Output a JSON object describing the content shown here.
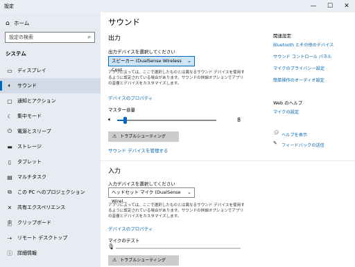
{
  "window": {
    "title": "設定",
    "minimize": "—",
    "maximize": "☐",
    "close": "✕"
  },
  "sidebar": {
    "home": {
      "label": "ホーム",
      "icon": "home-icon"
    },
    "search_placeholder": "設定の検索",
    "section": "システム",
    "items": [
      {
        "label": "ディスプレイ",
        "icon": "display-icon"
      },
      {
        "label": "サウンド",
        "icon": "speaker-icon"
      },
      {
        "label": "通知とアクション",
        "icon": "notification-icon"
      },
      {
        "label": "集中モード",
        "icon": "moon-icon"
      },
      {
        "label": "電源とスリープ",
        "icon": "power-icon"
      },
      {
        "label": "ストレージ",
        "icon": "storage-icon"
      },
      {
        "label": "タブレット",
        "icon": "tablet-icon"
      },
      {
        "label": "マルチタスク",
        "icon": "multitask-icon"
      },
      {
        "label": "この PC へのプロジェクション",
        "icon": "projection-icon"
      },
      {
        "label": "共有エクスペリエンス",
        "icon": "share-icon"
      },
      {
        "label": "クリップボード",
        "icon": "clipboard-icon"
      },
      {
        "label": "リモート デスクトップ",
        "icon": "remote-icon"
      },
      {
        "label": "詳細情報",
        "icon": "info-icon"
      }
    ]
  },
  "main": {
    "title": "サウンド",
    "output": {
      "heading": "出力",
      "device_label": "出力デバイスを選択してください",
      "device_value": "スピーカー (DualSense Wireless Cont...",
      "description": "アプリによっては、ここで選択したものとは異なるサウンド デバイスを使用するように設定されている場合があります。サウンドの詳細オプションでアプリの音量とデバイスをカスタマイズします。",
      "properties_link": "デバイスのプロパティ",
      "volume_label": "マスター音量",
      "volume_value": "8",
      "volume_level": 0.08,
      "troubleshoot": "トラブルシューティング",
      "manage_link": "サウンド デバイスを管理する"
    },
    "input": {
      "heading": "入力",
      "device_label": "入力デバイスを選択してください",
      "device_value": "ヘッドセット マイク (DualSense Wirel...",
      "description": "アプリによっては、ここで選択したものとは異なるサウンド デバイスを使用するように設定されている場合があります。サウンドの詳細オプションでアプリの音量とデバイスをカスタマイズします。",
      "properties_link": "デバイスのプロパティ",
      "mic_test_label": "マイクのテスト",
      "troubleshoot": "トラブルシューティング"
    }
  },
  "right": {
    "related_heading": "関連設定",
    "related_links": [
      "Bluetooth とその他のデバイス",
      "サウンド コントロール パネル",
      "マイクのプライバシー設定",
      "簡単操作のオーディオ設定"
    ],
    "web_heading": "Web のヘルプ",
    "web_link": "マイクの設定",
    "help_link": "ヘルプを表示",
    "feedback_link": "フィードバックの送信"
  },
  "colors": {
    "accent": "#0067c0",
    "link": "#0066b4",
    "sidebar": "#e6ecf2"
  }
}
